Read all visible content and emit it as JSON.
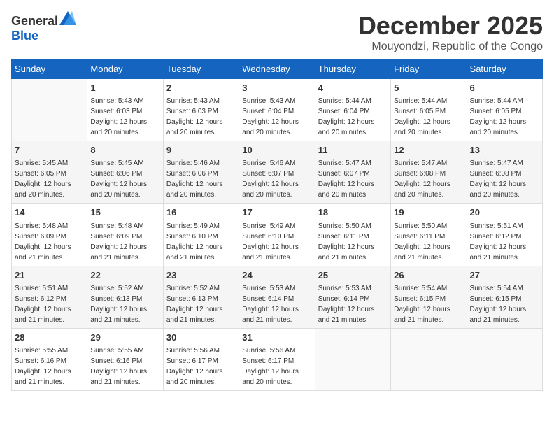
{
  "logo": {
    "general": "General",
    "blue": "Blue"
  },
  "header": {
    "month": "December 2025",
    "location": "Mouyondzi, Republic of the Congo"
  },
  "weekdays": [
    "Sunday",
    "Monday",
    "Tuesday",
    "Wednesday",
    "Thursday",
    "Friday",
    "Saturday"
  ],
  "weeks": [
    [
      {
        "day": "",
        "sunrise": "",
        "sunset": "",
        "daylight": ""
      },
      {
        "day": "1",
        "sunrise": "Sunrise: 5:43 AM",
        "sunset": "Sunset: 6:03 PM",
        "daylight": "Daylight: 12 hours and 20 minutes."
      },
      {
        "day": "2",
        "sunrise": "Sunrise: 5:43 AM",
        "sunset": "Sunset: 6:03 PM",
        "daylight": "Daylight: 12 hours and 20 minutes."
      },
      {
        "day": "3",
        "sunrise": "Sunrise: 5:43 AM",
        "sunset": "Sunset: 6:04 PM",
        "daylight": "Daylight: 12 hours and 20 minutes."
      },
      {
        "day": "4",
        "sunrise": "Sunrise: 5:44 AM",
        "sunset": "Sunset: 6:04 PM",
        "daylight": "Daylight: 12 hours and 20 minutes."
      },
      {
        "day": "5",
        "sunrise": "Sunrise: 5:44 AM",
        "sunset": "Sunset: 6:05 PM",
        "daylight": "Daylight: 12 hours and 20 minutes."
      },
      {
        "day": "6",
        "sunrise": "Sunrise: 5:44 AM",
        "sunset": "Sunset: 6:05 PM",
        "daylight": "Daylight: 12 hours and 20 minutes."
      }
    ],
    [
      {
        "day": "7",
        "sunrise": "Sunrise: 5:45 AM",
        "sunset": "Sunset: 6:05 PM",
        "daylight": "Daylight: 12 hours and 20 minutes."
      },
      {
        "day": "8",
        "sunrise": "Sunrise: 5:45 AM",
        "sunset": "Sunset: 6:06 PM",
        "daylight": "Daylight: 12 hours and 20 minutes."
      },
      {
        "day": "9",
        "sunrise": "Sunrise: 5:46 AM",
        "sunset": "Sunset: 6:06 PM",
        "daylight": "Daylight: 12 hours and 20 minutes."
      },
      {
        "day": "10",
        "sunrise": "Sunrise: 5:46 AM",
        "sunset": "Sunset: 6:07 PM",
        "daylight": "Daylight: 12 hours and 20 minutes."
      },
      {
        "day": "11",
        "sunrise": "Sunrise: 5:47 AM",
        "sunset": "Sunset: 6:07 PM",
        "daylight": "Daylight: 12 hours and 20 minutes."
      },
      {
        "day": "12",
        "sunrise": "Sunrise: 5:47 AM",
        "sunset": "Sunset: 6:08 PM",
        "daylight": "Daylight: 12 hours and 20 minutes."
      },
      {
        "day": "13",
        "sunrise": "Sunrise: 5:47 AM",
        "sunset": "Sunset: 6:08 PM",
        "daylight": "Daylight: 12 hours and 20 minutes."
      }
    ],
    [
      {
        "day": "14",
        "sunrise": "Sunrise: 5:48 AM",
        "sunset": "Sunset: 6:09 PM",
        "daylight": "Daylight: 12 hours and 21 minutes."
      },
      {
        "day": "15",
        "sunrise": "Sunrise: 5:48 AM",
        "sunset": "Sunset: 6:09 PM",
        "daylight": "Daylight: 12 hours and 21 minutes."
      },
      {
        "day": "16",
        "sunrise": "Sunrise: 5:49 AM",
        "sunset": "Sunset: 6:10 PM",
        "daylight": "Daylight: 12 hours and 21 minutes."
      },
      {
        "day": "17",
        "sunrise": "Sunrise: 5:49 AM",
        "sunset": "Sunset: 6:10 PM",
        "daylight": "Daylight: 12 hours and 21 minutes."
      },
      {
        "day": "18",
        "sunrise": "Sunrise: 5:50 AM",
        "sunset": "Sunset: 6:11 PM",
        "daylight": "Daylight: 12 hours and 21 minutes."
      },
      {
        "day": "19",
        "sunrise": "Sunrise: 5:50 AM",
        "sunset": "Sunset: 6:11 PM",
        "daylight": "Daylight: 12 hours and 21 minutes."
      },
      {
        "day": "20",
        "sunrise": "Sunrise: 5:51 AM",
        "sunset": "Sunset: 6:12 PM",
        "daylight": "Daylight: 12 hours and 21 minutes."
      }
    ],
    [
      {
        "day": "21",
        "sunrise": "Sunrise: 5:51 AM",
        "sunset": "Sunset: 6:12 PM",
        "daylight": "Daylight: 12 hours and 21 minutes."
      },
      {
        "day": "22",
        "sunrise": "Sunrise: 5:52 AM",
        "sunset": "Sunset: 6:13 PM",
        "daylight": "Daylight: 12 hours and 21 minutes."
      },
      {
        "day": "23",
        "sunrise": "Sunrise: 5:52 AM",
        "sunset": "Sunset: 6:13 PM",
        "daylight": "Daylight: 12 hours and 21 minutes."
      },
      {
        "day": "24",
        "sunrise": "Sunrise: 5:53 AM",
        "sunset": "Sunset: 6:14 PM",
        "daylight": "Daylight: 12 hours and 21 minutes."
      },
      {
        "day": "25",
        "sunrise": "Sunrise: 5:53 AM",
        "sunset": "Sunset: 6:14 PM",
        "daylight": "Daylight: 12 hours and 21 minutes."
      },
      {
        "day": "26",
        "sunrise": "Sunrise: 5:54 AM",
        "sunset": "Sunset: 6:15 PM",
        "daylight": "Daylight: 12 hours and 21 minutes."
      },
      {
        "day": "27",
        "sunrise": "Sunrise: 5:54 AM",
        "sunset": "Sunset: 6:15 PM",
        "daylight": "Daylight: 12 hours and 21 minutes."
      }
    ],
    [
      {
        "day": "28",
        "sunrise": "Sunrise: 5:55 AM",
        "sunset": "Sunset: 6:16 PM",
        "daylight": "Daylight: 12 hours and 21 minutes."
      },
      {
        "day": "29",
        "sunrise": "Sunrise: 5:55 AM",
        "sunset": "Sunset: 6:16 PM",
        "daylight": "Daylight: 12 hours and 21 minutes."
      },
      {
        "day": "30",
        "sunrise": "Sunrise: 5:56 AM",
        "sunset": "Sunset: 6:17 PM",
        "daylight": "Daylight: 12 hours and 20 minutes."
      },
      {
        "day": "31",
        "sunrise": "Sunrise: 5:56 AM",
        "sunset": "Sunset: 6:17 PM",
        "daylight": "Daylight: 12 hours and 20 minutes."
      },
      {
        "day": "",
        "sunrise": "",
        "sunset": "",
        "daylight": ""
      },
      {
        "day": "",
        "sunrise": "",
        "sunset": "",
        "daylight": ""
      },
      {
        "day": "",
        "sunrise": "",
        "sunset": "",
        "daylight": ""
      }
    ]
  ]
}
